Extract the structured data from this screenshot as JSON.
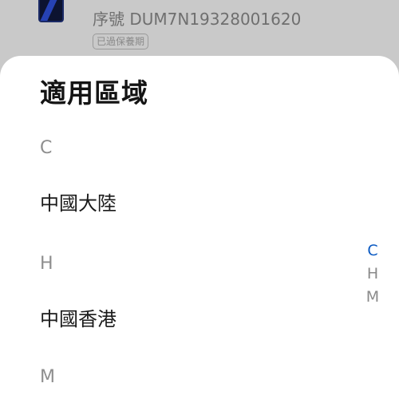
{
  "background": {
    "serial_text": "序號 DUM7N19328001620",
    "warranty_badge": "已過保養期"
  },
  "sheet": {
    "title": "適用區域",
    "sections": [
      {
        "header": "C",
        "items": [
          "中國大陸"
        ]
      },
      {
        "header": "H",
        "items": [
          "中國香港"
        ]
      },
      {
        "header": "M",
        "items": []
      }
    ]
  },
  "index_bar": {
    "letters": [
      "C",
      "H",
      "M"
    ],
    "active": "C",
    "active_color": "#0a59c2"
  }
}
